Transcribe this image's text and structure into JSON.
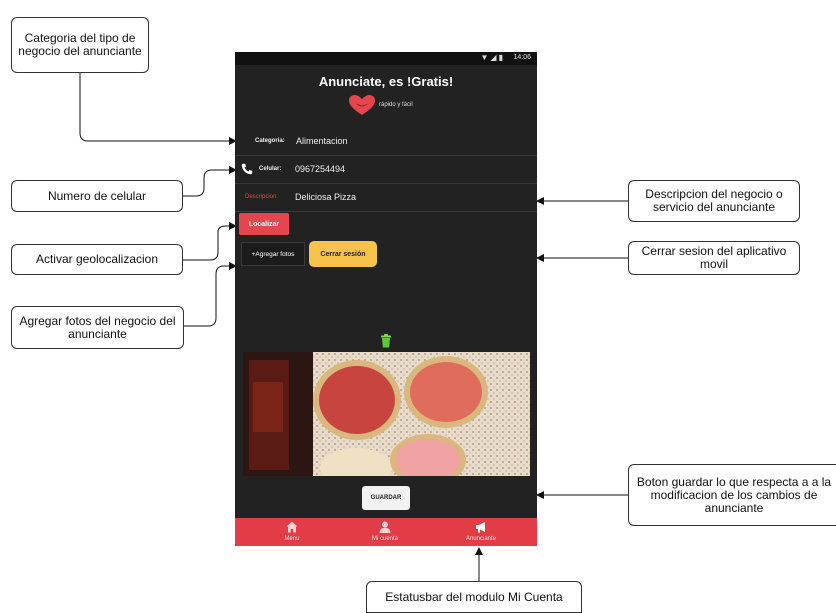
{
  "callouts": {
    "categoria": "Categoria del tipo de negocio del anunciante",
    "celular": "Numero de celular",
    "geolocalizacion": "Activar geolocalizacion",
    "fotos": "Agregar fotos del negocio del anunciante",
    "descripcion": "Descripcion del negocio o servicio del anunciante",
    "cerrar_sesion": "Cerrar sesion del aplicativo movil",
    "guardar": "Boton guardar lo que respecta a a la modificacion de los cambios de anunciante",
    "statusbar": "Estatusbar del modulo Mi Cuenta"
  },
  "phone": {
    "status_time": "14:06",
    "title": "Anunciate, es !Gratis!",
    "tagline": "rápido y fácil",
    "fields": {
      "categoria_label": "Categoria:",
      "categoria_value": "Alimentacion",
      "celular_label": "Celular:",
      "celular_value": "0967254494",
      "descripcion_label": "Descripcion:",
      "descripcion_value": "Deliciosa Pizza"
    },
    "buttons": {
      "localizar": "Localizar",
      "agregar_fotos": "+Agregar fotos",
      "cerrar_sesion": "Cerrar sesión",
      "guardar": "GUARDAR"
    },
    "tabs": [
      {
        "label": "Menu",
        "icon": "home-icon"
      },
      {
        "label": "Mi cuenta",
        "icon": "user-icon"
      },
      {
        "label": "Anunciante",
        "icon": "megaphone-icon"
      }
    ]
  },
  "colors": {
    "phone_bg": "#222222",
    "accent_red": "#e23d46",
    "button_yellow": "#f8c34a"
  }
}
